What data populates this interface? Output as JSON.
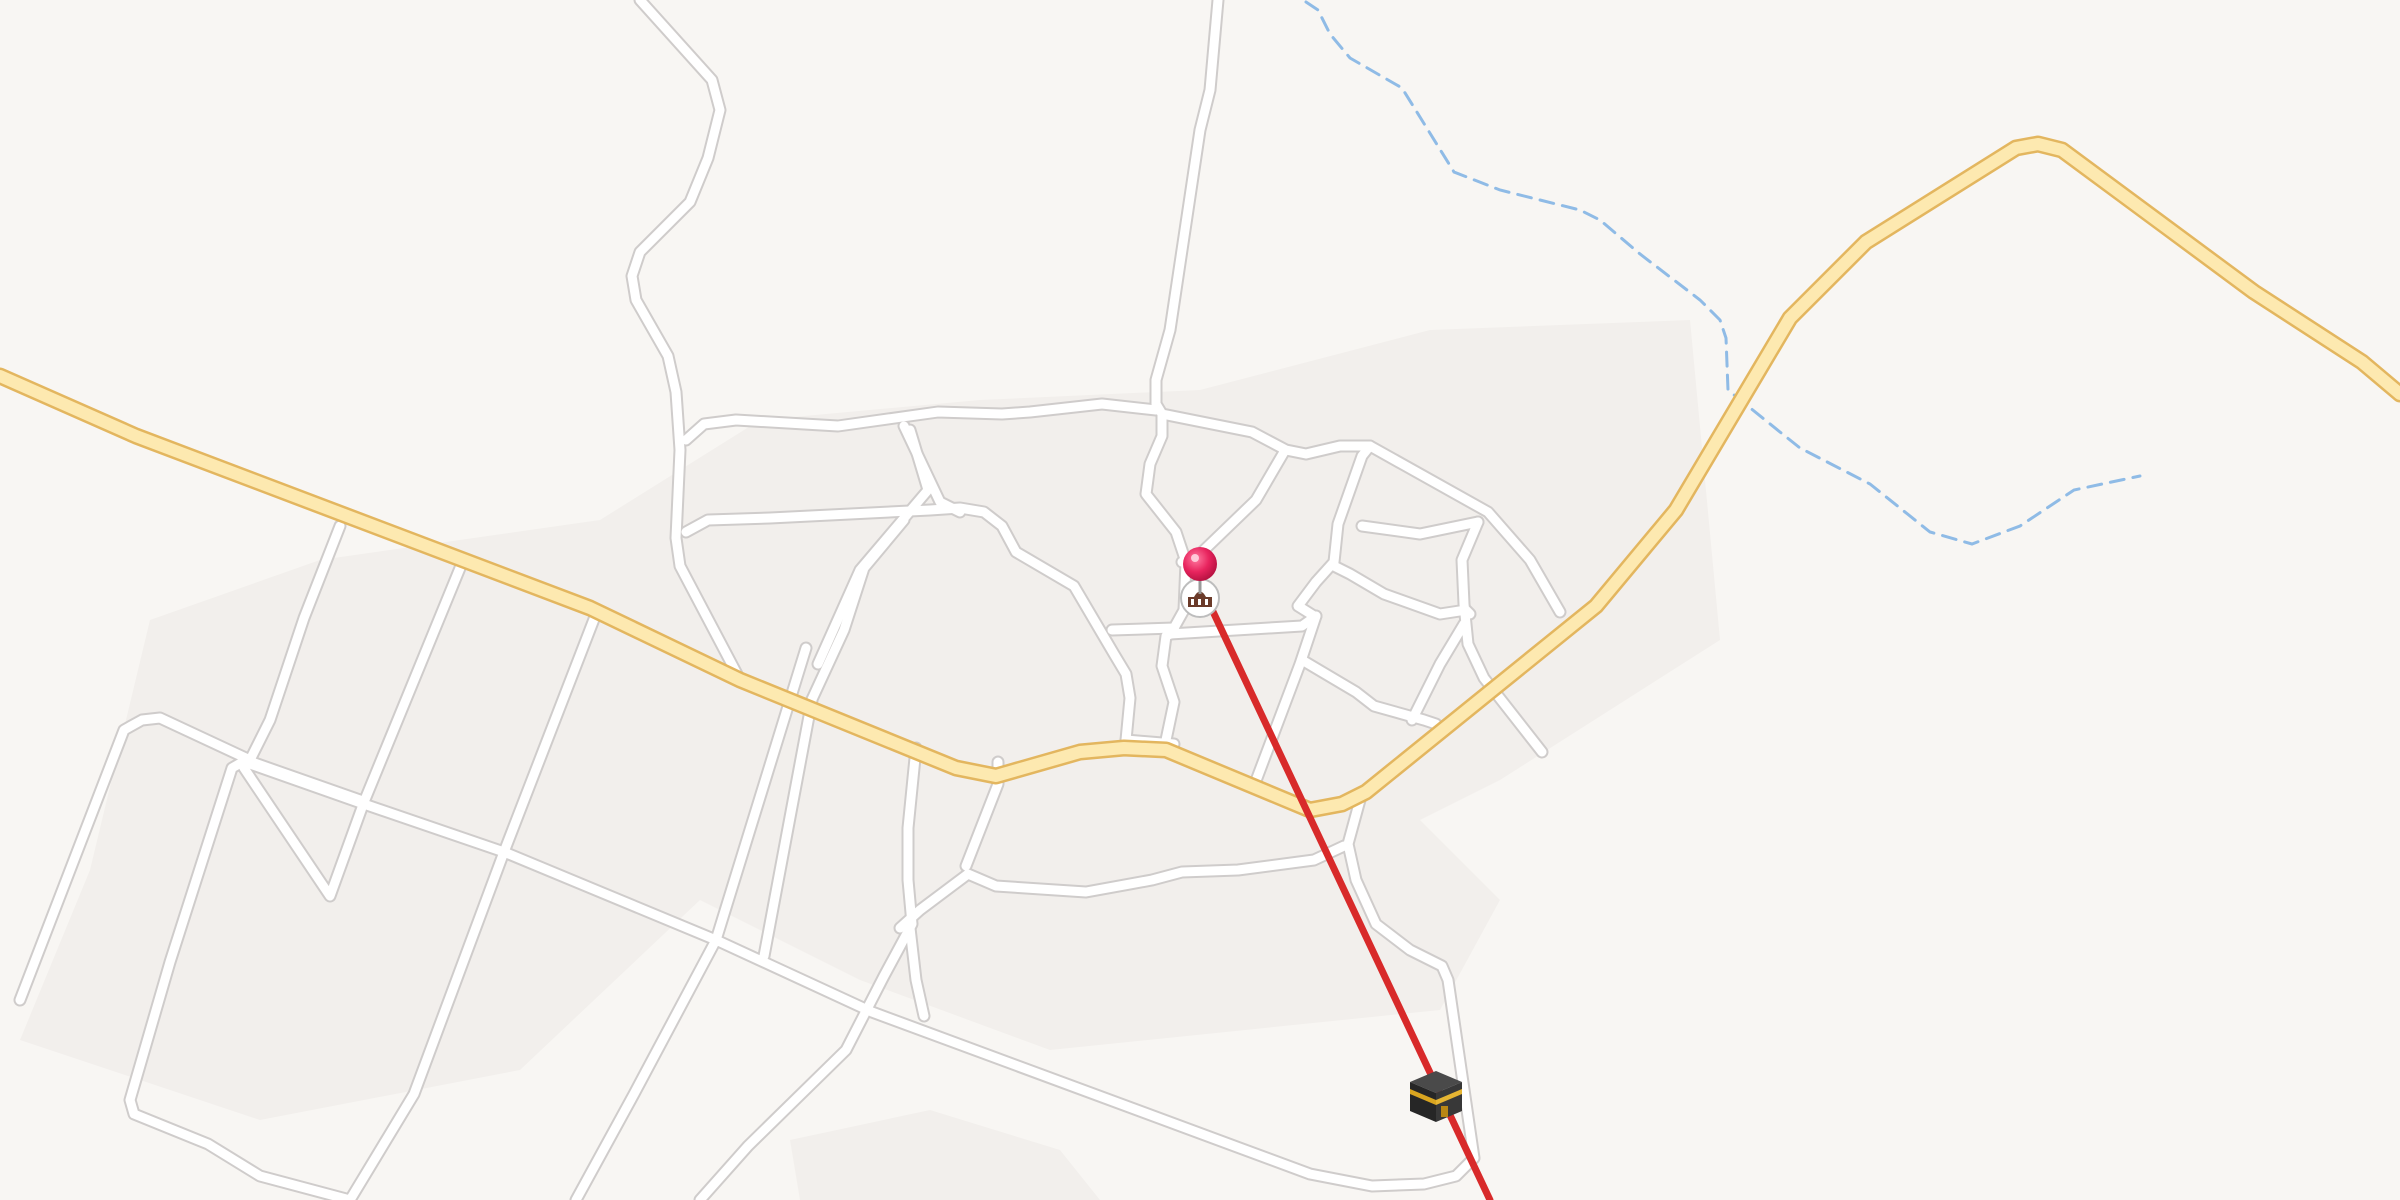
{
  "map": {
    "style": "light street map",
    "colors": {
      "land": "#f8f6f3",
      "urban_area": "#f2efec",
      "minor_road": "#ffffff",
      "road_casing": "#cfcccb",
      "highway": "#fde9b0",
      "highway_casing": "#e3b65f",
      "waterway": "#8fbbe6",
      "direction_line": "#d82a2a",
      "location_pin": "#e8245e"
    }
  },
  "markers": {
    "location_pin_icon": "map-pin-icon",
    "mosque_icon": "mosque-icon",
    "kaaba_icon": "kaaba-icon",
    "direction_line": "qibla-direction-line"
  }
}
